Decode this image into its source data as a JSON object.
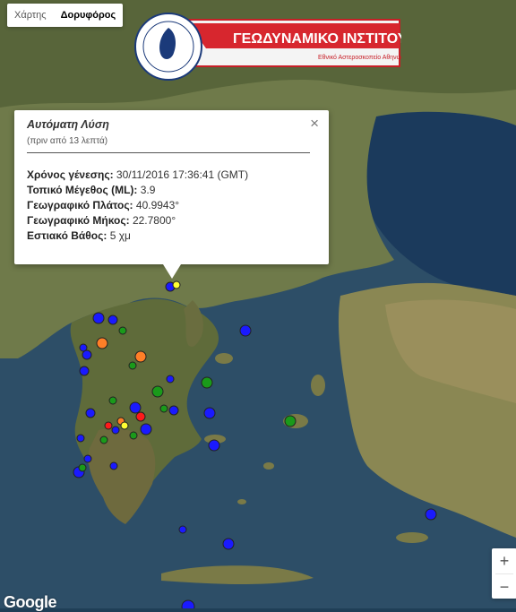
{
  "map_type": {
    "map_label": "Χάρτης",
    "satellite_label": "Δορυφόρος",
    "selected": "satellite"
  },
  "logo": {
    "title": "ΓΕΩΔΥΝΑΜΙΚΟ ΙΝΣΤΙΤΟΥΤΟ",
    "subtitle": "Εθνικό Αστεροσκοπείο Αθηνών",
    "accent": "#d7262e"
  },
  "popup": {
    "title": "Αυτόματη Λύση",
    "subtitle": "(πριν από 13 λεπτά)",
    "close": "×",
    "fields": [
      {
        "label": "Χρόνος γένεσης:",
        "value": "30/11/2016  17:36:41 (GMT)"
      },
      {
        "label": "Τοπικό Μέγεθος (ML):",
        "value": "3.9"
      },
      {
        "label": "Γεωγραφικό Πλάτος:",
        "value": "40.9943°"
      },
      {
        "label": "Γεωγραφικό Μήκος:",
        "value": "22.7800°"
      },
      {
        "label": "Εστιακό Βάθος:",
        "value": "5 χμ"
      }
    ]
  },
  "zoom": {
    "in": "+",
    "out": "−"
  },
  "attribution": "Google",
  "marker_colors": {
    "blue": "#1a1aff",
    "orange": "#ff7f27",
    "green": "#1a9a1a",
    "red": "#ff1a1a",
    "yellow": "#ffff33"
  }
}
